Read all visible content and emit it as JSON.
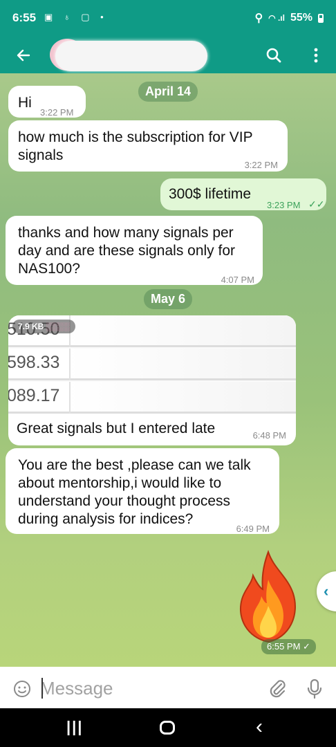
{
  "status": {
    "time": "6:55",
    "battery": "55%"
  },
  "header": {
    "back_icon": "back-arrow-icon"
  },
  "messages": [
    {
      "date_separator": "April 14"
    },
    {
      "text": "Hi",
      "time": "3:22 PM"
    },
    {
      "text": "how much is the subscription for VIP signals",
      "time": "3:22 PM"
    },
    {
      "text": "300$ lifetime",
      "time": "3:23 PM"
    },
    {
      "text": "thanks and how many signals per day and are these signals only for NAS100?",
      "time": "4:07 PM"
    },
    {
      "date_separator": "May 6"
    },
    {
      "image_size": "7.9 KB",
      "image_values": [
        "510.50",
        "598.33",
        "089.17"
      ],
      "caption": "Great signals but I entered late",
      "time": "6:48 PM"
    },
    {
      "text": "You are the best ,please can we talk about mentorship,i would like to understand your thought process during analysis for indices?",
      "time": "6:49 PM"
    },
    {
      "sticker": "fire-emoji",
      "time": "6:55 PM"
    }
  ],
  "input": {
    "placeholder": "Message"
  },
  "colors": {
    "header": "#0f9b86",
    "outgoing_bubble": "#e1f7d6",
    "read_check": "#3ca25a"
  }
}
